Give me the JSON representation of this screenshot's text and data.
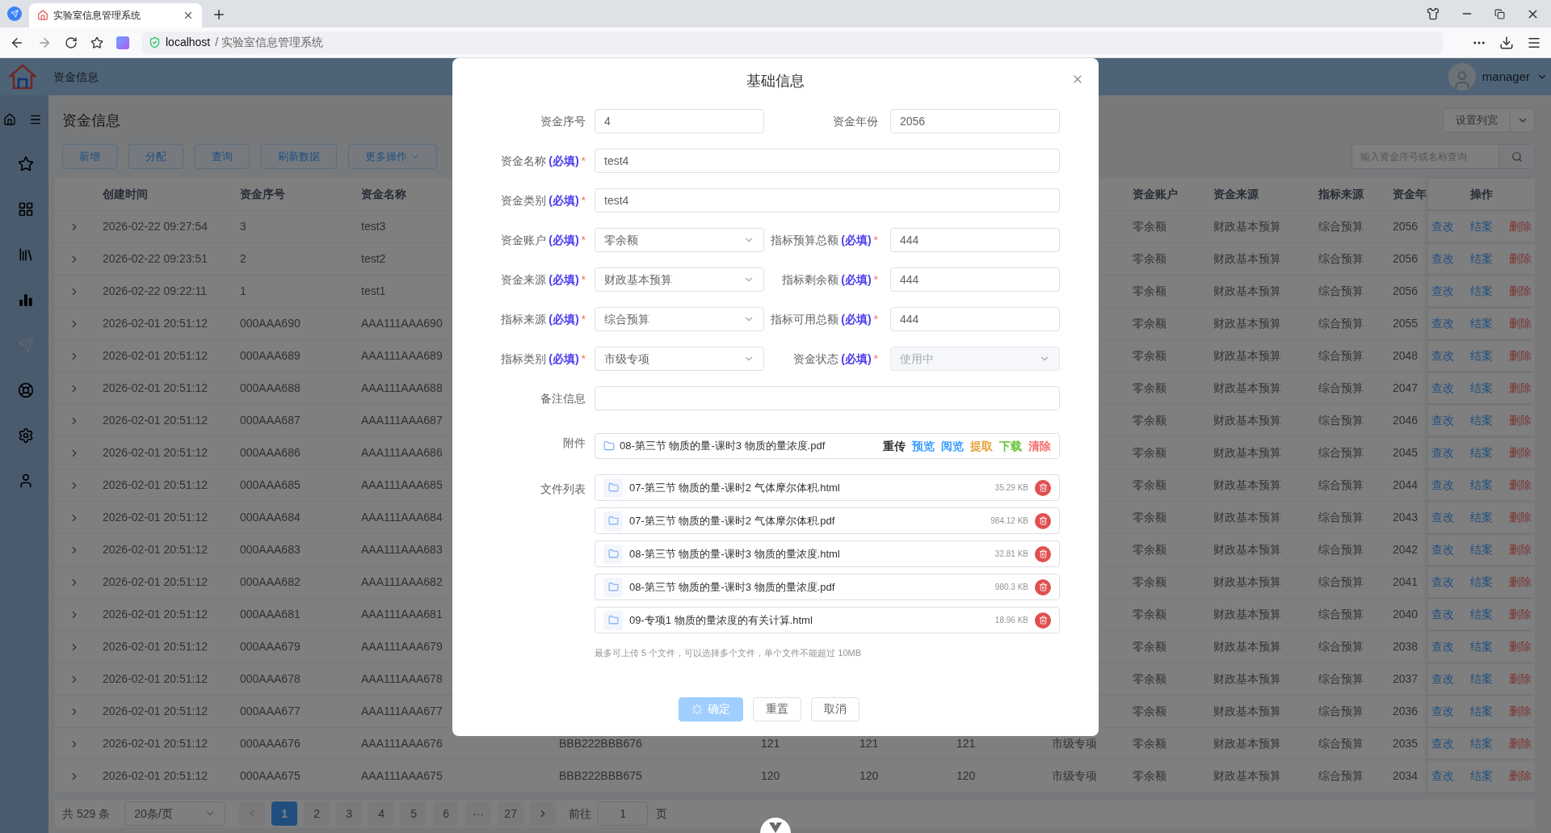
{
  "browser": {
    "tab_title": "实验室信息管理系统",
    "address_host": "localhost",
    "address_path": "/ 实验室信息管理系统"
  },
  "header": {
    "breadcrumb": "资金信息",
    "user": "manager"
  },
  "sidebar": {
    "items": [
      {
        "disabled": false
      },
      {
        "disabled": false
      },
      {
        "disabled": false
      },
      {
        "disabled": false
      },
      {
        "disabled": true
      },
      {
        "disabled": false
      },
      {
        "disabled": false
      },
      {
        "disabled": false
      }
    ]
  },
  "page": {
    "title": "资金信息",
    "actions": [
      {
        "label": "新增",
        "dropdown": false
      },
      {
        "label": "分配",
        "dropdown": false
      },
      {
        "label": "查询",
        "dropdown": false
      },
      {
        "label": "刷新数据",
        "dropdown": false
      },
      {
        "label": "更多操作",
        "dropdown": true
      }
    ],
    "column_width_button": "设置列宽",
    "search": {
      "placeholder": "输入资金序号或名称查询"
    }
  },
  "table": {
    "columns": {
      "created": "创建时间",
      "serial": "资金序号",
      "name": "资金名称",
      "account": "资金账户",
      "source": "资金来源",
      "index_source": "指标来源",
      "year": "资金年",
      "actions": "操作"
    },
    "rows": [
      {
        "expanded": false,
        "created": "2026-02-22 09:27:54",
        "serial": "3",
        "name": "test3",
        "account": "零余额",
        "source": "财政基本预算",
        "index_source": "综合预算",
        "year": "2056",
        "actions": [
          "查改",
          "结案",
          "删除"
        ]
      },
      {
        "expanded": false,
        "created": "2026-02-22 09:23:51",
        "serial": "2",
        "name": "test2",
        "account": "零余额",
        "source": "财政基本预算",
        "index_source": "综合预算",
        "year": "2056",
        "actions": [
          "查改",
          "结案",
          "删除"
        ]
      },
      {
        "expanded": false,
        "created": "2026-02-22 09:22:11",
        "serial": "1",
        "name": "test1",
        "account": "零余额",
        "source": "财政基本预算",
        "index_source": "综合预算",
        "year": "2056",
        "actions": [
          "查改",
          "结案",
          "删除"
        ]
      },
      {
        "expanded": false,
        "created": "2026-02-01 20:51:12",
        "serial": "000AAA690",
        "name": "AAA111AAA690",
        "account": "零余额",
        "source": "财政基本预算",
        "index_source": "综合预算",
        "year": "2055",
        "actions": [
          "查改",
          "结案",
          "删除"
        ]
      },
      {
        "expanded": false,
        "created": "2026-02-01 20:51:12",
        "serial": "000AAA689",
        "name": "AAA111AAA689",
        "account": "零余额",
        "source": "财政基本预算",
        "index_source": "综合预算",
        "year": "2048",
        "actions": [
          "查改",
          "结案",
          "删除"
        ]
      },
      {
        "expanded": false,
        "created": "2026-02-01 20:51:12",
        "serial": "000AAA688",
        "name": "AAA111AAA688",
        "account": "零余额",
        "source": "财政基本预算",
        "index_source": "综合预算",
        "year": "2047",
        "actions": [
          "查改",
          "结案",
          "删除"
        ]
      },
      {
        "expanded": false,
        "created": "2026-02-01 20:51:12",
        "serial": "000AAA687",
        "name": "AAA111AAA687",
        "account": "零余额",
        "source": "财政基本预算",
        "index_source": "综合预算",
        "year": "2046",
        "actions": [
          "查改",
          "结案",
          "删除"
        ]
      },
      {
        "expanded": false,
        "created": "2026-02-01 20:51:12",
        "serial": "000AAA686",
        "name": "AAA111AAA686",
        "account": "零余额",
        "source": "财政基本预算",
        "index_source": "综合预算",
        "year": "2045",
        "actions": [
          "查改",
          "结案",
          "删除"
        ]
      },
      {
        "expanded": false,
        "created": "2026-02-01 20:51:12",
        "serial": "000AAA685",
        "name": "AAA111AAA685",
        "account": "零余额",
        "source": "财政基本预算",
        "index_source": "综合预算",
        "year": "2044",
        "actions": [
          "查改",
          "结案",
          "删除"
        ]
      },
      {
        "expanded": false,
        "created": "2026-02-01 20:51:12",
        "serial": "000AAA684",
        "name": "AAA111AAA684",
        "account": "零余额",
        "source": "财政基本预算",
        "index_source": "综合预算",
        "year": "2043",
        "actions": [
          "查改",
          "结案",
          "删除"
        ]
      },
      {
        "expanded": false,
        "created": "2026-02-01 20:51:12",
        "serial": "000AAA683",
        "name": "AAA111AAA683",
        "account": "零余额",
        "source": "财政基本预算",
        "index_source": "综合预算",
        "year": "2042",
        "actions": [
          "查改",
          "结案",
          "删除"
        ]
      },
      {
        "expanded": false,
        "created": "2026-02-01 20:51:12",
        "serial": "000AAA682",
        "name": "AAA111AAA682",
        "account": "零余额",
        "source": "财政基本预算",
        "index_source": "综合预算",
        "year": "2041",
        "actions": [
          "查改",
          "结案",
          "删除"
        ]
      },
      {
        "expanded": false,
        "created": "2026-02-01 20:51:12",
        "serial": "000AAA681",
        "name": "AAA111AAA681",
        "account": "零余额",
        "source": "财政基本预算",
        "index_source": "综合预算",
        "year": "2040",
        "actions": [
          "查改",
          "结案",
          "删除"
        ]
      },
      {
        "expanded": false,
        "created": "2026-02-01 20:51:12",
        "serial": "000AAA679",
        "name": "AAA111AAA679",
        "account": "零余额",
        "source": "财政基本预算",
        "index_source": "综合预算",
        "year": "2038",
        "actions": [
          "查改",
          "结案",
          "删除"
        ]
      },
      {
        "expanded": false,
        "created": "2026-02-01 20:51:12",
        "serial": "000AAA678",
        "name": "AAA111AAA678",
        "account": "零余额",
        "source": "财政基本预算",
        "index_source": "综合预算",
        "year": "2037",
        "actions": [
          "查改",
          "结案",
          "删除"
        ]
      },
      {
        "expanded": false,
        "created": "2026-02-01 20:51:12",
        "serial": "000AAA677",
        "name": "AAA111AAA677",
        "account": "零余额",
        "source": "财政基本预算",
        "index_source": "综合预算",
        "year": "2036",
        "actions": [
          "查改",
          "结案",
          "删除"
        ]
      },
      {
        "expanded": false,
        "created": "2026-02-01 20:51:12",
        "serial": "000AAA676",
        "name": "AAA111AAA676",
        "column_4": "BBB222BBB676",
        "column_5": "121",
        "column_6": "121",
        "column_7": "121",
        "column_8": "市级专项",
        "account": "零余额",
        "source": "财政基本预算",
        "index_source": "综合预算",
        "year": "2035",
        "actions": [
          "查改",
          "结案",
          "删除"
        ]
      },
      {
        "expanded": false,
        "created": "2026-02-01 20:51:12",
        "serial": "000AAA675",
        "name": "AAA111AAA675",
        "column_4": "BBB222BBB675",
        "column_5": "120",
        "column_6": "120",
        "column_7": "120",
        "column_8": "市级专项",
        "account": "零余额",
        "source": "财政基本预算",
        "index_source": "综合预算",
        "year": "2034",
        "actions": [
          "查改",
          "结案",
          "删除"
        ]
      }
    ]
  },
  "pagination": {
    "total": "共 529 条",
    "page_size": "20条/页",
    "pages": [
      {
        "label": "1",
        "selected": true
      },
      {
        "label": "2",
        "selected": false
      },
      {
        "label": "3",
        "selected": false
      },
      {
        "label": "4",
        "selected": false
      },
      {
        "label": "5",
        "selected": false
      },
      {
        "label": "6",
        "selected": false
      },
      {
        "label": "···",
        "selected": false
      },
      {
        "label": "27",
        "selected": false
      }
    ],
    "goto_label": "前往",
    "goto_value": "1",
    "page_unit": "页"
  },
  "modal": {
    "title": "基础信息",
    "rows": [
      [
        {
          "label": "资金序号",
          "kind": "text",
          "value": "4",
          "disabled": false
        },
        {
          "label": "资金年份",
          "kind": "text",
          "value": "2056",
          "disabled": false
        }
      ],
      [
        {
          "label": "资金名称",
          "hint": "(必填)",
          "asterisk": "*",
          "kind": "text",
          "value": "test4",
          "disabled": false
        }
      ],
      [
        {
          "label": "资金类别",
          "hint": "(必填)",
          "asterisk": "*",
          "kind": "text",
          "value": "test4",
          "disabled": false
        }
      ],
      [
        {
          "label": "资金账户",
          "hint": "(必填)",
          "asterisk": "*",
          "kind": "select",
          "value": "零余额",
          "disabled": false
        },
        {
          "label": "指标预算总额",
          "hint": "(必填)",
          "asterisk": "*",
          "kind": "text",
          "value": "444",
          "disabled": false
        }
      ],
      [
        {
          "label": "资金来源",
          "hint": "(必填)",
          "asterisk": "*",
          "kind": "select",
          "value": "财政基本预算",
          "disabled": false
        },
        {
          "label": "指标剩余额",
          "hint": "(必填)",
          "asterisk": "*",
          "kind": "text",
          "value": "444",
          "disabled": false
        }
      ],
      [
        {
          "label": "指标来源",
          "hint": "(必填)",
          "asterisk": "*",
          "kind": "select",
          "value": "综合预算",
          "disabled": false
        },
        {
          "label": "指标可用总额",
          "hint": "(必填)",
          "asterisk": "*",
          "kind": "text",
          "value": "444",
          "disabled": false
        }
      ],
      [
        {
          "label": "指标类别",
          "hint": "(必填)",
          "asterisk": "*",
          "kind": "select",
          "value": "市级专项",
          "disabled": false
        },
        {
          "label": "资金状态",
          "hint": "(必填)",
          "asterisk": "*",
          "kind": "select",
          "value": "使用中",
          "disabled": true
        }
      ],
      [
        {
          "label": "备注信息",
          "kind": "text"
        }
      ]
    ],
    "attachment": {
      "label": "附件",
      "file": "08-第三节 物质的量-课时3 物质的量浓度.pdf",
      "actions": [
        {
          "label": "重传",
          "color": "#303133"
        },
        {
          "label": "预览",
          "color": "#409eff"
        },
        {
          "label": "阅览",
          "color": "#409eff"
        },
        {
          "label": "提取",
          "color": "#e6a23c"
        },
        {
          "label": "下载",
          "color": "#67c23a"
        },
        {
          "label": "清除",
          "color": "#f56c6c"
        }
      ]
    },
    "files": {
      "label": "文件列表",
      "items": [
        {
          "name": "07-第三节 物质的量-课时2 气体摩尔体积.html",
          "size": "35.29 KB"
        },
        {
          "name": "07-第三节 物质的量-课时2 气体摩尔体积.pdf",
          "size": "984.12 KB"
        },
        {
          "name": "08-第三节 物质的量-课时3 物质的量浓度.html",
          "size": "32.81 KB"
        },
        {
          "name": "08-第三节 物质的量-课时3 物质的量浓度.pdf",
          "size": "980.3 KB"
        },
        {
          "name": "09-专项1 物质的量浓度的有关计算.html",
          "size": "18.96 KB"
        }
      ],
      "note": "最多可上传 5 个文件，可以选择多个文件，单个文件不能超过 10MB"
    },
    "buttons": [
      {
        "label": "确定",
        "kind": "primary",
        "loading": true,
        "disabled": true
      },
      {
        "label": "重置",
        "kind": "default",
        "loading": false,
        "disabled": false
      },
      {
        "label": "取消",
        "kind": "default",
        "loading": false,
        "disabled": false
      }
    ]
  }
}
